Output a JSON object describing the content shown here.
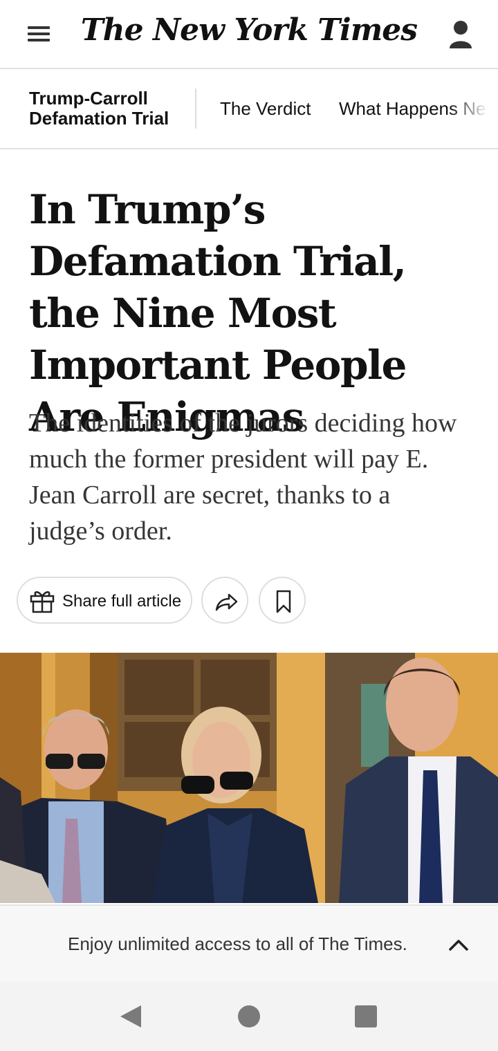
{
  "header": {
    "logo_text": "The New York Times",
    "menu_icon": "hamburger-menu-icon",
    "account_icon": "user-account-icon"
  },
  "subnav": {
    "section_title": "Trump-Carroll Defamation Trial",
    "links": [
      "The Verdict",
      "What Happens Next"
    ]
  },
  "article": {
    "headline": "In Trump’s Defamation Trial, the Nine Most Important People Are Enigmas",
    "summary": "The identities of the jurors deciding how much the former president will pay E. Jean Carroll are secret, thanks to a judge’s order."
  },
  "share_bar": {
    "share_full_label": "Share full article",
    "gift_icon": "gift-icon",
    "share_icon": "share-arrow-icon",
    "save_icon": "bookmark-icon"
  },
  "banner": {
    "text": "Enjoy unlimited access to all of The Times.",
    "icon": "chevron-up-icon"
  },
  "system_nav": {
    "back_icon": "back-triangle-icon",
    "home_icon": "home-circle-icon",
    "recents_icon": "recents-square-icon"
  },
  "colors": {
    "text": "#121212",
    "summary_text": "#363636",
    "divider": "#e2e2e2",
    "banner_bg": "#f7f7f7"
  }
}
